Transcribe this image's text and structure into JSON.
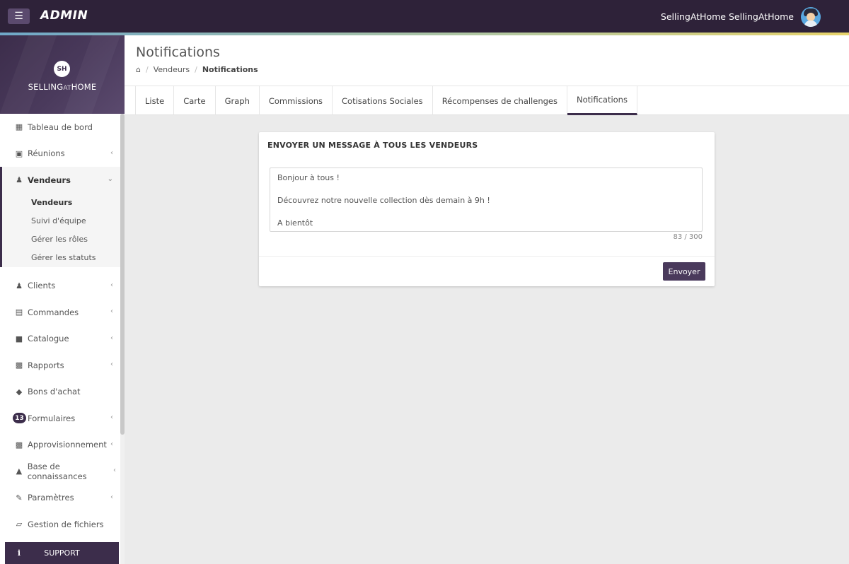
{
  "topbar": {
    "brand": "ADMIN",
    "user_name": "SellingAtHome SellingAtHome",
    "menu_icon": "hamburger-icon"
  },
  "logo": {
    "circle": "SH",
    "text_a": "SELLING",
    "text_b": "AT",
    "text_c": "HOME"
  },
  "sidebar": {
    "items_top": [
      {
        "label": "Tableau de bord",
        "icon": "dashboard-icon"
      },
      {
        "label": "Réunions",
        "icon": "calendar-icon"
      }
    ],
    "group": {
      "label": "Vendeurs",
      "icon": "users-icon",
      "sub": [
        {
          "label": "Vendeurs"
        },
        {
          "label": "Suivi d'équipe"
        },
        {
          "label": "Gérer les rôles"
        },
        {
          "label": "Gérer les statuts"
        }
      ]
    },
    "items_bottom": [
      {
        "label": "Clients",
        "icon": "users-icon"
      },
      {
        "label": "Commandes",
        "icon": "credit-card-icon"
      },
      {
        "label": "Catalogue",
        "icon": "book-icon"
      },
      {
        "label": "Rapports",
        "icon": "bar-chart-icon"
      },
      {
        "label": "Bons d'achat",
        "icon": "tags-icon"
      },
      {
        "label": "Formulaires",
        "icon": "form-icon",
        "badge": "13"
      },
      {
        "label": "Approvisionnement",
        "icon": "industry-icon"
      },
      {
        "label": "Base de connaissances",
        "icon": "graduation-cap-icon"
      },
      {
        "label": "Paramètres",
        "icon": "wrench-icon"
      },
      {
        "label": "Gestion de fichiers",
        "icon": "folder-open-icon"
      }
    ],
    "support_label": "SUPPORT"
  },
  "header": {
    "title": "Notifications",
    "breadcrumb": [
      "Vendeurs",
      "Notifications"
    ]
  },
  "tabs": [
    "Liste",
    "Carte",
    "Graph",
    "Commissions",
    "Cotisations Sociales",
    "Récompenses de challenges",
    "Notifications"
  ],
  "card": {
    "title": "ENVOYER UN MESSAGE À TOUS LES VENDEURS",
    "message": "Bonjour à tous !\n\nDécouvrez notre nouvelle collection dès demain à 9h !\n\nA bientôt",
    "char_count": "83 / 300",
    "send_label": "Envoyer"
  },
  "colors": {
    "topbar": "#2e2239",
    "brand_purple": "#3c2d4b",
    "button": "#4a3a5c",
    "background": "#ebebeb"
  }
}
